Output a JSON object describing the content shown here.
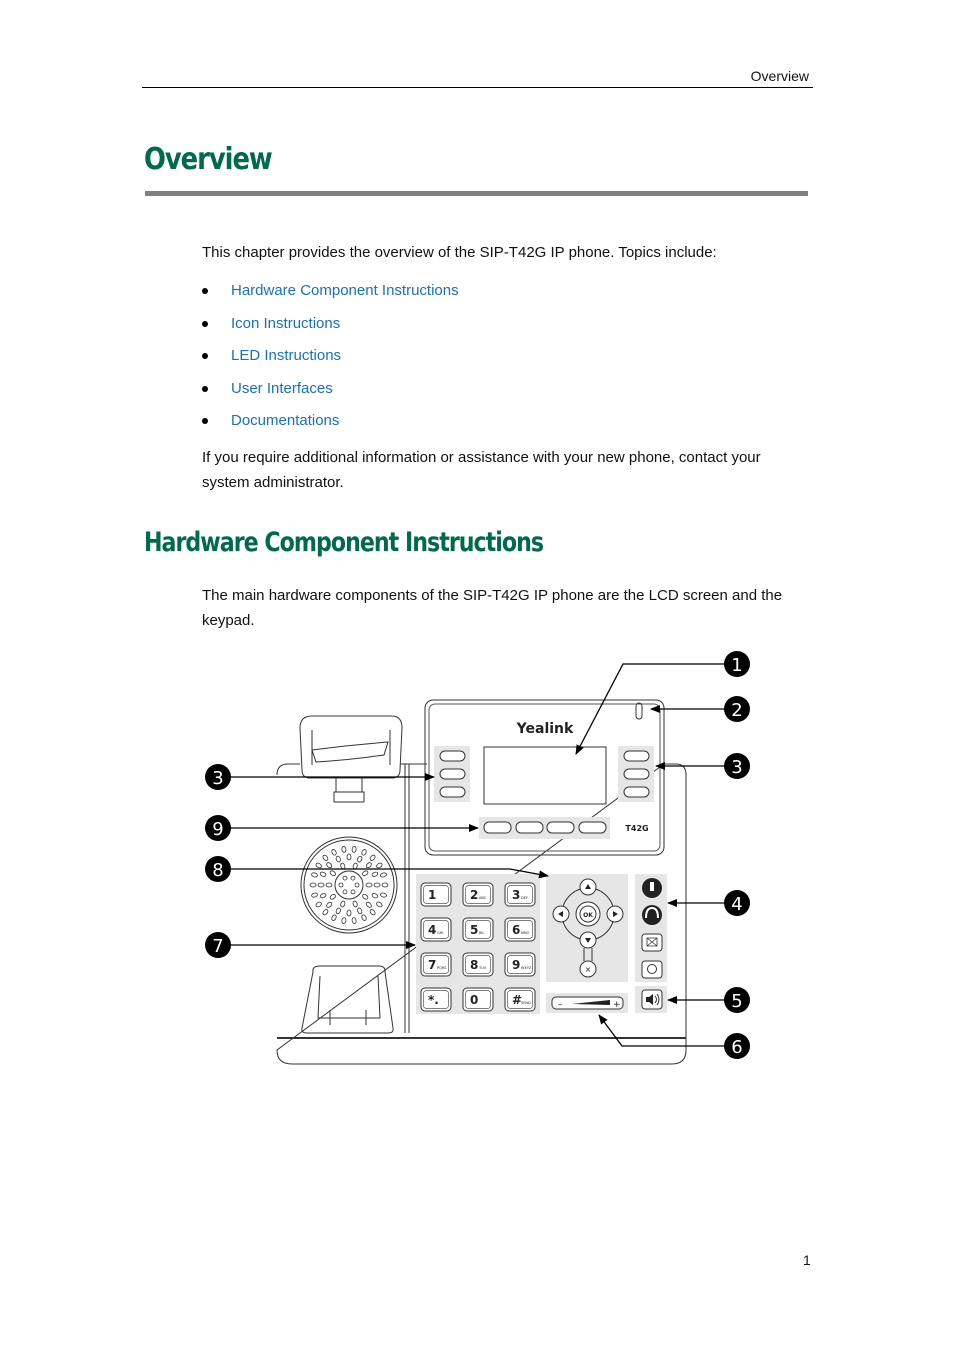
{
  "header": {
    "running_title": "Overview"
  },
  "chapter": {
    "title": "Overview",
    "intro": "This chapter provides the overview of the SIP-T42G IP phone. Topics include:",
    "topics": [
      {
        "label": "Hardware Component Instructions"
      },
      {
        "label": "Icon Instructions"
      },
      {
        "label": "LED Instructions"
      },
      {
        "label": "User Interfaces"
      },
      {
        "label": "Documentations"
      }
    ],
    "contact_note": "If you require additional information or assistance with your new phone, contact your system administrator."
  },
  "section": {
    "title": "Hardware Component Instructions",
    "body": "The main hardware components of the SIP-T42G IP phone are the LCD screen and the keypad."
  },
  "figure": {
    "brand": "Yealink",
    "model": "T42G",
    "callouts": [
      "1",
      "2",
      "3",
      "3",
      "4",
      "5",
      "6",
      "7",
      "8",
      "9"
    ],
    "keypad": [
      {
        "digit": "1",
        "letters": ""
      },
      {
        "digit": "2",
        "letters": "ABC"
      },
      {
        "digit": "3",
        "letters": "DEF"
      },
      {
        "digit": "4",
        "letters": "GHI"
      },
      {
        "digit": "5",
        "letters": "JKL"
      },
      {
        "digit": "6",
        "letters": "MNO"
      },
      {
        "digit": "7",
        "letters": "PQRS"
      },
      {
        "digit": "8",
        "letters": "TUV"
      },
      {
        "digit": "9",
        "letters": "WXYZ"
      },
      {
        "digit": "*.",
        "letters": ""
      },
      {
        "digit": "0",
        "letters": ""
      },
      {
        "digit": "#",
        "letters": "SEND"
      }
    ],
    "ok_label": "OK",
    "volume_minus": "–",
    "volume_plus": "+"
  },
  "footer": {
    "page_number": "1"
  }
}
